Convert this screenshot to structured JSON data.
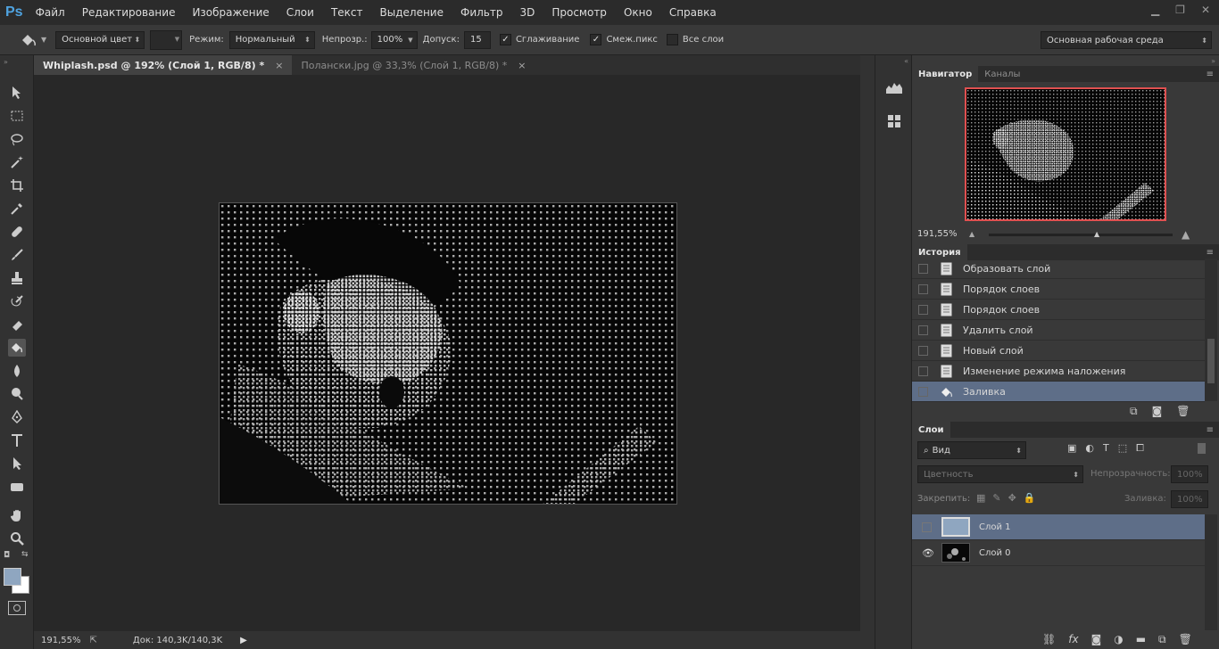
{
  "app": {
    "logo": "Ps"
  },
  "menu": [
    "Файл",
    "Редактирование",
    "Изображение",
    "Слои",
    "Текст",
    "Выделение",
    "Фильтр",
    "3D",
    "Просмотр",
    "Окно",
    "Справка"
  ],
  "options": {
    "fill_source": "Основной цвет",
    "mode_label": "Режим:",
    "mode_value": "Нормальный",
    "opacity_label": "Непрозр.:",
    "opacity_value": "100%",
    "tolerance_label": "Допуск:",
    "tolerance_value": "15",
    "antialias_label": "Сглаживание",
    "antialias_checked": "✓",
    "contiguous_label": "Смеж.пикс",
    "contiguous_checked": "✓",
    "all_layers_label": "Все слои",
    "workspace": "Основная рабочая среда"
  },
  "tabs": [
    {
      "label": "Whiplash.psd @ 192% (Слой 1, RGB/8) *",
      "close": "×"
    },
    {
      "label": "Полански.jpg @ 33,3% (Слой 1, RGB/8) *",
      "close": "×"
    }
  ],
  "status": {
    "zoom": "191,55%",
    "doc": "Док: 140,3K/140,3K"
  },
  "navigator": {
    "tab_navigator": "Навигатор",
    "tab_channels": "Каналы",
    "zoom": "191,55%"
  },
  "history": {
    "tab": "История",
    "items": [
      "Образовать слой",
      "Порядок слоев",
      "Порядок слоев",
      "Удалить слой",
      "Новый слой",
      "Изменение режима наложения",
      "Заливка"
    ]
  },
  "layers": {
    "tab": "Слои",
    "filter_label": "Вид",
    "blend_mode": "Цветность",
    "opacity_label": "Непрозрачность:",
    "opacity_value": "100%",
    "lock_label": "Закрепить:",
    "fill_label": "Заливка:",
    "fill_value": "100%",
    "items": [
      {
        "name": "Слой 1",
        "visible": false,
        "selected": true
      },
      {
        "name": "Слой 0",
        "visible": true,
        "selected": false
      }
    ]
  },
  "colors": {
    "foreground": "#8fa6c0",
    "background": "#ffffff",
    "selection": "#5e6e88",
    "navigator_frame": "#e05050",
    "logo": "#4fa3e0"
  }
}
